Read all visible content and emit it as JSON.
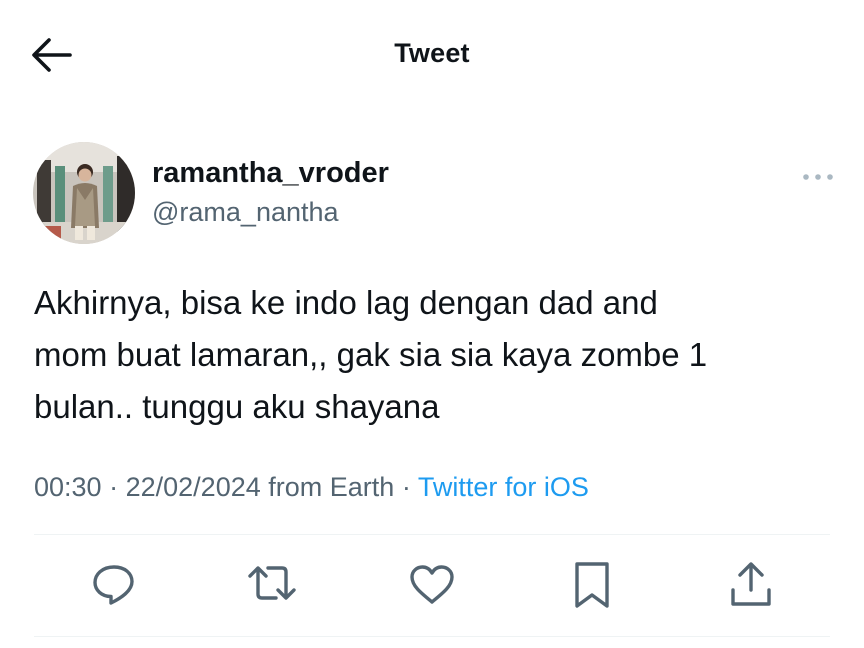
{
  "header": {
    "title": "Tweet",
    "back_icon": "arrow-left-icon"
  },
  "author": {
    "display_name": "ramantha_vroder",
    "handle": "@rama_nantha"
  },
  "tweet": {
    "text_lines": [
      "Akhirnya, bisa ke indo lag dengan dad and",
      "mom buat lamaran,, gak sia sia kaya zombe 1",
      "bulan.. tunggu aku shayana"
    ],
    "time": "00:30",
    "separator": "·",
    "date": "22/02/2024",
    "location": "from Earth",
    "source": "Twitter for iOS"
  },
  "actions": {
    "icons": [
      "reply-icon",
      "retweet-icon",
      "like-icon",
      "bookmark-icon",
      "share-icon"
    ]
  },
  "colors": {
    "text": "#0f1419",
    "secondary": "#536471",
    "link": "#1d9bf0",
    "divider": "#eff3f4"
  }
}
